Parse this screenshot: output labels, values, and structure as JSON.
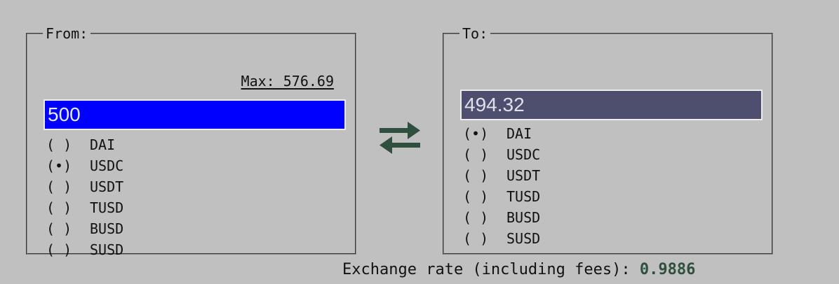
{
  "from": {
    "legend": "From:",
    "max_label": "Max: 576.69",
    "amount": "500",
    "options": [
      {
        "mark": "( )",
        "label": "DAI"
      },
      {
        "mark": "(•)",
        "label": "USDC"
      },
      {
        "mark": "( )",
        "label": "USDT"
      },
      {
        "mark": "( )",
        "label": "TUSD"
      },
      {
        "mark": "( )",
        "label": "BUSD"
      },
      {
        "mark": "( )",
        "label": "SUSD"
      }
    ]
  },
  "to": {
    "legend": "To:",
    "amount": "494.32",
    "options": [
      {
        "mark": "(•)",
        "label": "DAI"
      },
      {
        "mark": "( )",
        "label": "USDC"
      },
      {
        "mark": "( )",
        "label": "USDT"
      },
      {
        "mark": "( )",
        "label": "TUSD"
      },
      {
        "mark": "( )",
        "label": "BUSD"
      },
      {
        "mark": "( )",
        "label": "SUSD"
      }
    ]
  },
  "swap": {
    "icon": "swap-arrows-icon",
    "color": "#2f4f3f"
  },
  "rate": {
    "label": "Exchange rate (including fees): ",
    "value": "0.9886"
  },
  "colors": {
    "background": "#c0c0c0",
    "from_input_bg": "#0000ff",
    "to_input_bg": "#4e4e6e",
    "rate_value": "#2f4f3f"
  }
}
